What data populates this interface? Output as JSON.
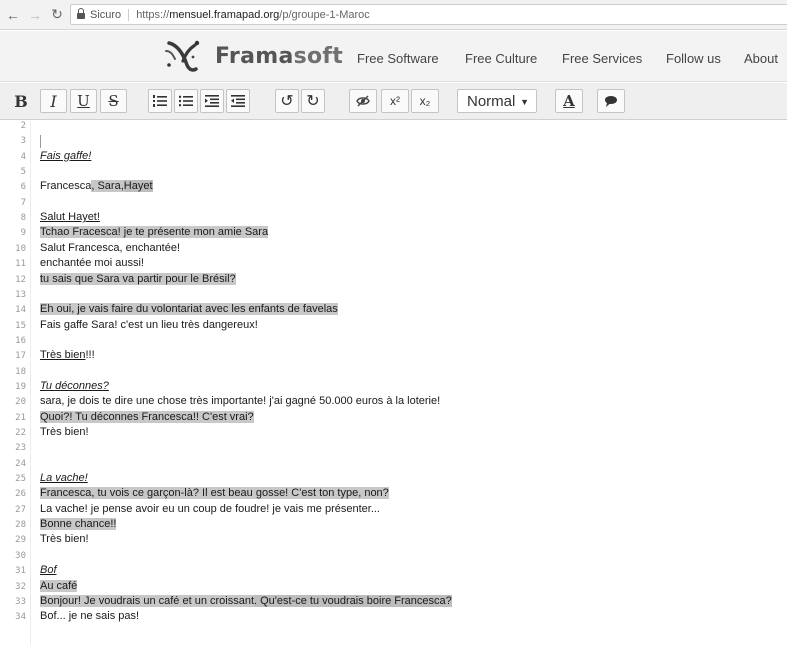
{
  "browser": {
    "secure_label": "Sicuro",
    "url_scheme": "https://",
    "url_host": "mensuel.framapad.org",
    "url_path": "/p/groupe-1-Maroc"
  },
  "nav": {
    "brand_main": "Frama",
    "brand_accent": "soft",
    "links": [
      "Free Software",
      "Free Culture",
      "Free Services",
      "Follow us",
      "About"
    ]
  },
  "toolbar": {
    "bold": "B",
    "italic": "I",
    "underline": "U",
    "strike": "S",
    "superscript": "x²",
    "subscript": "x₂",
    "format_value": "Normal",
    "text_color": "A"
  },
  "editor": {
    "lines": [
      {
        "n": "2",
        "segments": []
      },
      {
        "n": "3",
        "segments": []
      },
      {
        "n": "4",
        "segments": [
          {
            "t": "Fais gaffe!",
            "s": "it"
          }
        ]
      },
      {
        "n": "5",
        "segments": []
      },
      {
        "n": "6",
        "segments": [
          {
            "t": "Francesca",
            "s": ""
          },
          {
            "t": ", Sara,",
            "s": "hl"
          },
          {
            "t": "Hayet",
            "s": "hl2"
          }
        ]
      },
      {
        "n": "7",
        "segments": []
      },
      {
        "n": "8",
        "segments": [
          {
            "t": "Salut Hayet!",
            "s": "ul"
          }
        ]
      },
      {
        "n": "9",
        "segments": [
          {
            "t": "Tchao Fracesca! je te présente mon amie Sara",
            "s": "hl"
          }
        ]
      },
      {
        "n": "10",
        "segments": [
          {
            "t": "Salut Francesca, enchantée!",
            "s": ""
          }
        ]
      },
      {
        "n": "11",
        "segments": [
          {
            "t": "enchantée moi aussi!",
            "s": ""
          }
        ]
      },
      {
        "n": "12",
        "segments": [
          {
            "t": "tu sais que Sara va partir pour le Brésil?",
            "s": "hl"
          }
        ]
      },
      {
        "n": "13",
        "segments": []
      },
      {
        "n": "14",
        "segments": [
          {
            "t": "Eh oui, je vais faire du volontariat avec les enfants de favelas",
            "s": "hl"
          }
        ]
      },
      {
        "n": "15",
        "segments": [
          {
            "t": "Fais gaffe Sara! c'est un lieu très dangereux!",
            "s": ""
          }
        ]
      },
      {
        "n": "16",
        "segments": []
      },
      {
        "n": "17",
        "segments": [
          {
            "t": "Très bien",
            "s": "ul"
          },
          {
            "t": "!!!",
            "s": ""
          }
        ]
      },
      {
        "n": "18",
        "segments": []
      },
      {
        "n": "19",
        "segments": [
          {
            "t": "Tu déconnes?",
            "s": "it"
          }
        ]
      },
      {
        "n": "20",
        "segments": [
          {
            "t": "sara, je dois te dire une chose très importante! j'ai gagné 50.000 euros à la loterie!",
            "s": ""
          }
        ]
      },
      {
        "n": "21",
        "segments": [
          {
            "t": "Quoi?! Tu déconnes Francesca!! C'est vrai?",
            "s": "hl"
          }
        ]
      },
      {
        "n": "22",
        "segments": [
          {
            "t": "Très bien!",
            "s": ""
          }
        ]
      },
      {
        "n": "23",
        "segments": []
      },
      {
        "n": "24",
        "segments": []
      },
      {
        "n": "25",
        "segments": [
          {
            "t": "La vache!",
            "s": "it"
          }
        ]
      },
      {
        "n": "26",
        "segments": [
          {
            "t": "Francesca, tu vois ce garçon-là? Il est beau gosse! C'est ton type, non?",
            "s": "hl"
          }
        ]
      },
      {
        "n": "27",
        "segments": [
          {
            "t": "La vache! je pense avoir eu un coup de foudre! je vais me présenter...",
            "s": ""
          }
        ]
      },
      {
        "n": "28",
        "segments": [
          {
            "t": "Bonne chance!!",
            "s": "hl"
          }
        ]
      },
      {
        "n": "29",
        "segments": [
          {
            "t": "Très bien!",
            "s": ""
          }
        ]
      },
      {
        "n": "30",
        "segments": []
      },
      {
        "n": "31",
        "segments": [
          {
            "t": "Bof",
            "s": "it"
          }
        ]
      },
      {
        "n": "32",
        "segments": [
          {
            "t": "Au café",
            "s": "hl"
          }
        ]
      },
      {
        "n": "33",
        "segments": [
          {
            "t": "Bonjour! Je voudrais un café et un croissant",
            "s": "hl"
          },
          {
            "t": ". Qu'est-ce tu voudrais boire Francesca?",
            "s": "hl2"
          }
        ]
      },
      {
        "n": "34",
        "segments": [
          {
            "t": "Bof... je ne sais pas!",
            "s": ""
          }
        ]
      }
    ]
  }
}
